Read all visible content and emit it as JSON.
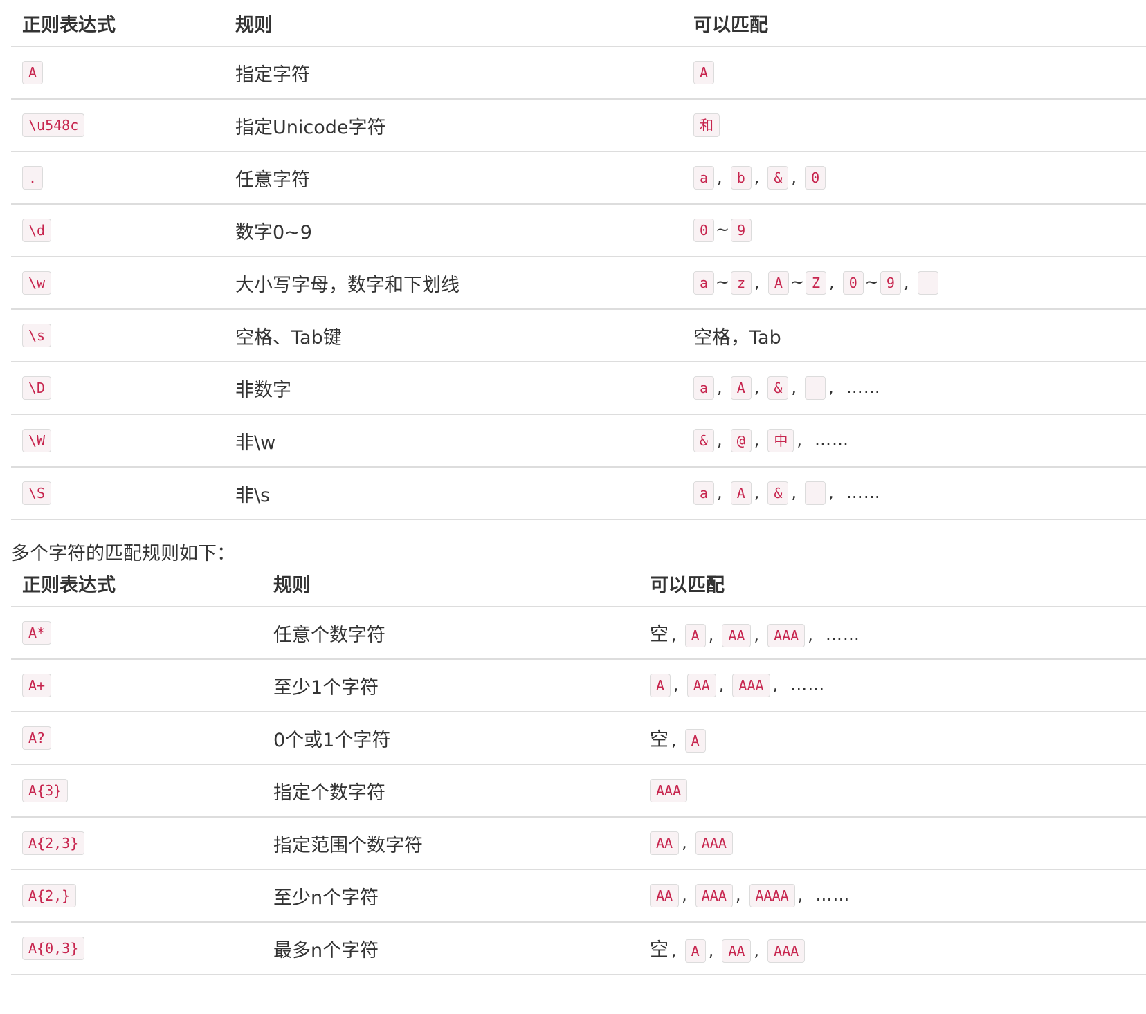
{
  "table1": {
    "headers": [
      "正则表达式",
      "规则",
      "可以匹配"
    ],
    "rows": [
      {
        "regex": "A",
        "rule": "指定字符",
        "matches": [
          {
            "t": "code",
            "v": "A"
          }
        ]
      },
      {
        "regex": "\\u548c",
        "rule": "指定Unicode字符",
        "matches": [
          {
            "t": "code",
            "v": "和"
          }
        ]
      },
      {
        "regex": ".",
        "rule": "任意字符",
        "matches": [
          {
            "t": "code",
            "v": "a"
          },
          {
            "t": "comma",
            "v": ","
          },
          {
            "t": "code",
            "v": "b"
          },
          {
            "t": "comma",
            "v": ","
          },
          {
            "t": "code",
            "v": "&"
          },
          {
            "t": "comma",
            "v": ","
          },
          {
            "t": "code",
            "v": "0"
          }
        ]
      },
      {
        "regex": "\\d",
        "rule": "数字0~9",
        "matches": [
          {
            "t": "code",
            "v": "0"
          },
          {
            "t": "tilde",
            "v": "~"
          },
          {
            "t": "code",
            "v": "9"
          }
        ]
      },
      {
        "regex": "\\w",
        "rule": "大小写字母，数字和下划线",
        "matches": [
          {
            "t": "code",
            "v": "a"
          },
          {
            "t": "tilde",
            "v": "~"
          },
          {
            "t": "code",
            "v": "z"
          },
          {
            "t": "comma",
            "v": ","
          },
          {
            "t": "code",
            "v": "A"
          },
          {
            "t": "tilde",
            "v": "~"
          },
          {
            "t": "code",
            "v": "Z"
          },
          {
            "t": "comma",
            "v": ","
          },
          {
            "t": "code",
            "v": "0"
          },
          {
            "t": "tilde",
            "v": "~"
          },
          {
            "t": "code",
            "v": "9"
          },
          {
            "t": "comma",
            "v": ","
          },
          {
            "t": "code",
            "v": "_"
          }
        ]
      },
      {
        "regex": "\\s",
        "rule": "空格、Tab键",
        "matches": [
          {
            "t": "text",
            "v": "空格，Tab"
          }
        ]
      },
      {
        "regex": "\\D",
        "rule": "非数字",
        "matches": [
          {
            "t": "code",
            "v": "a"
          },
          {
            "t": "comma",
            "v": ","
          },
          {
            "t": "code",
            "v": "A"
          },
          {
            "t": "comma",
            "v": ","
          },
          {
            "t": "code",
            "v": "&"
          },
          {
            "t": "comma",
            "v": ","
          },
          {
            "t": "code",
            "v": "_"
          },
          {
            "t": "comma",
            "v": ","
          },
          {
            "t": "ellipsis",
            "v": "……"
          }
        ]
      },
      {
        "regex": "\\W",
        "rule": "非\\w",
        "matches": [
          {
            "t": "code",
            "v": "&"
          },
          {
            "t": "comma",
            "v": ","
          },
          {
            "t": "code",
            "v": "@"
          },
          {
            "t": "comma",
            "v": ","
          },
          {
            "t": "code",
            "v": "中"
          },
          {
            "t": "comma",
            "v": ","
          },
          {
            "t": "ellipsis",
            "v": "……"
          }
        ]
      },
      {
        "regex": "\\S",
        "rule": "非\\s",
        "matches": [
          {
            "t": "code",
            "v": "a"
          },
          {
            "t": "comma",
            "v": ","
          },
          {
            "t": "code",
            "v": "A"
          },
          {
            "t": "comma",
            "v": ","
          },
          {
            "t": "code",
            "v": "&"
          },
          {
            "t": "comma",
            "v": ","
          },
          {
            "t": "code",
            "v": "_"
          },
          {
            "t": "comma",
            "v": ","
          },
          {
            "t": "ellipsis",
            "v": "……"
          }
        ]
      }
    ]
  },
  "middle_text": "多个字符的匹配规则如下：",
  "table2": {
    "headers": [
      "正则表达式",
      "规则",
      "可以匹配"
    ],
    "rows": [
      {
        "regex": "A*",
        "rule": "任意个数字符",
        "matches": [
          {
            "t": "text",
            "v": "空"
          },
          {
            "t": "comma",
            "v": ","
          },
          {
            "t": "code",
            "v": "A"
          },
          {
            "t": "comma",
            "v": ","
          },
          {
            "t": "code",
            "v": "AA"
          },
          {
            "t": "comma",
            "v": ","
          },
          {
            "t": "code",
            "v": "AAA"
          },
          {
            "t": "comma",
            "v": ","
          },
          {
            "t": "ellipsis",
            "v": "……"
          }
        ]
      },
      {
        "regex": "A+",
        "rule": "至少1个字符",
        "matches": [
          {
            "t": "code",
            "v": "A"
          },
          {
            "t": "comma",
            "v": ","
          },
          {
            "t": "code",
            "v": "AA"
          },
          {
            "t": "comma",
            "v": ","
          },
          {
            "t": "code",
            "v": "AAA"
          },
          {
            "t": "comma",
            "v": ","
          },
          {
            "t": "ellipsis",
            "v": "……"
          }
        ]
      },
      {
        "regex": "A?",
        "rule": "0个或1个字符",
        "matches": [
          {
            "t": "text",
            "v": "空"
          },
          {
            "t": "comma",
            "v": ","
          },
          {
            "t": "code",
            "v": "A"
          }
        ]
      },
      {
        "regex": "A{3}",
        "rule": "指定个数字符",
        "matches": [
          {
            "t": "code",
            "v": "AAA"
          }
        ]
      },
      {
        "regex": "A{2,3}",
        "rule": "指定范围个数字符",
        "matches": [
          {
            "t": "code",
            "v": "AA"
          },
          {
            "t": "comma",
            "v": ","
          },
          {
            "t": "code",
            "v": "AAA"
          }
        ]
      },
      {
        "regex": "A{2,}",
        "rule": "至少n个字符",
        "matches": [
          {
            "t": "code",
            "v": "AA"
          },
          {
            "t": "comma",
            "v": ","
          },
          {
            "t": "code",
            "v": "AAA"
          },
          {
            "t": "comma",
            "v": ","
          },
          {
            "t": "code",
            "v": "AAAA"
          },
          {
            "t": "comma",
            "v": ","
          },
          {
            "t": "ellipsis",
            "v": "……"
          }
        ]
      },
      {
        "regex": "A{0,3}",
        "rule": "最多n个字符",
        "matches": [
          {
            "t": "text",
            "v": "空"
          },
          {
            "t": "comma",
            "v": ","
          },
          {
            "t": "code",
            "v": "A"
          },
          {
            "t": "comma",
            "v": ","
          },
          {
            "t": "code",
            "v": "AA"
          },
          {
            "t": "comma",
            "v": ","
          },
          {
            "t": "code",
            "v": "AAA"
          }
        ]
      }
    ]
  }
}
